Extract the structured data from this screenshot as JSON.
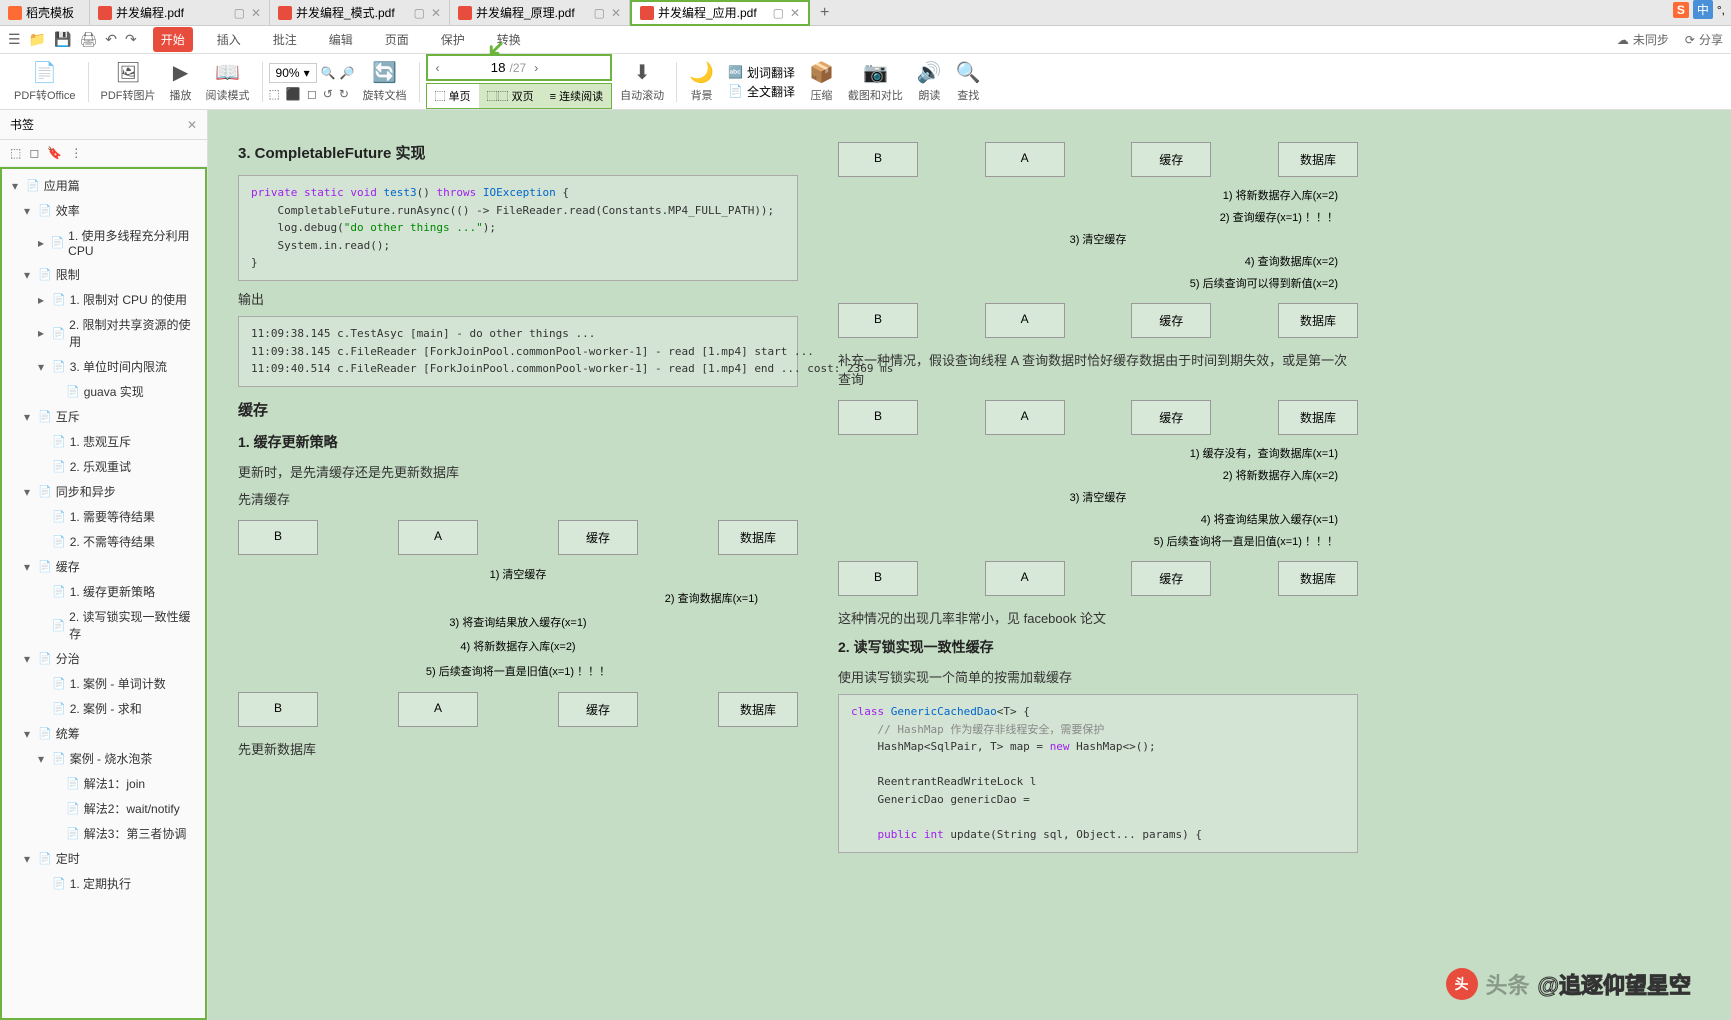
{
  "tabs": [
    {
      "icon": "orange",
      "label": "稻壳模板"
    },
    {
      "icon": "pdf",
      "label": "并发编程.pdf"
    },
    {
      "icon": "pdf",
      "label": "并发编程_模式.pdf"
    },
    {
      "icon": "pdf",
      "label": "并发编程_原理.pdf"
    },
    {
      "icon": "pdf",
      "label": "并发编程_应用.pdf",
      "active": true
    }
  ],
  "lang": {
    "s": "S",
    "cn": "中"
  },
  "menu": {
    "tabs": [
      "开始",
      "插入",
      "批注",
      "编辑",
      "页面",
      "保护",
      "转换"
    ],
    "active": "开始",
    "sync": "未同步",
    "share": "分享"
  },
  "toolbar": {
    "pdf_office": "PDF转Office",
    "pdf_img": "PDF转图片",
    "play": "播放",
    "read_mode": "阅读模式",
    "zoom": "90%",
    "rotate": "旋转文档",
    "page_current": "18",
    "page_total": "/27",
    "single": "单页",
    "double": "双页",
    "continuous": "连续阅读",
    "auto_scroll": "自动滚动",
    "bg": "背景",
    "word_trans": "划词翻译",
    "full_trans": "全文翻译",
    "compress": "压缩",
    "screenshot": "截图和对比",
    "read_aloud": "朗读",
    "find": "查找"
  },
  "sidebar": {
    "title": "书签",
    "items": [
      {
        "level": 0,
        "toggle": "▾",
        "label": "应用篇"
      },
      {
        "level": 1,
        "toggle": "▾",
        "label": "效率"
      },
      {
        "level": 2,
        "toggle": "▸",
        "label": "1. 使用多线程充分利用 CPU"
      },
      {
        "level": 1,
        "toggle": "▾",
        "label": "限制"
      },
      {
        "level": 2,
        "toggle": "▸",
        "label": "1. 限制对 CPU 的使用"
      },
      {
        "level": 2,
        "toggle": "▸",
        "label": "2. 限制对共享资源的使用"
      },
      {
        "level": 2,
        "toggle": "▾",
        "label": "3. 单位时间内限流"
      },
      {
        "level": 3,
        "toggle": "",
        "label": "guava 实现"
      },
      {
        "level": 1,
        "toggle": "▾",
        "label": "互斥"
      },
      {
        "level": 2,
        "toggle": "",
        "label": "1. 悲观互斥"
      },
      {
        "level": 2,
        "toggle": "",
        "label": "2. 乐观重试"
      },
      {
        "level": 1,
        "toggle": "▾",
        "label": "同步和异步"
      },
      {
        "level": 2,
        "toggle": "",
        "label": "1. 需要等待结果"
      },
      {
        "level": 2,
        "toggle": "",
        "label": "2. 不需等待结果"
      },
      {
        "level": 1,
        "toggle": "▾",
        "label": "缓存"
      },
      {
        "level": 2,
        "toggle": "",
        "label": "1. 缓存更新策略"
      },
      {
        "level": 2,
        "toggle": "",
        "label": "2. 读写锁实现一致性缓存"
      },
      {
        "level": 1,
        "toggle": "▾",
        "label": "分治"
      },
      {
        "level": 2,
        "toggle": "",
        "label": "1. 案例 - 单词计数"
      },
      {
        "level": 2,
        "toggle": "",
        "label": "2. 案例 - 求和"
      },
      {
        "level": 1,
        "toggle": "▾",
        "label": "统筹"
      },
      {
        "level": 2,
        "toggle": "▾",
        "label": "案例 - 烧水泡茶"
      },
      {
        "level": 3,
        "toggle": "",
        "label": "解法1：join"
      },
      {
        "level": 3,
        "toggle": "",
        "label": "解法2：wait/notify"
      },
      {
        "level": 3,
        "toggle": "",
        "label": "解法3：第三者协调"
      },
      {
        "level": 1,
        "toggle": "▾",
        "label": "定时"
      },
      {
        "level": 2,
        "toggle": "",
        "label": "1. 定期执行"
      }
    ]
  },
  "content": {
    "h1": "3. CompletableFuture 实现",
    "code1_l1": "private static void test3() throws IOException {",
    "code1_l2": "    CompletableFuture.runAsync(() -> FileReader.read(Constants.MP4_FULL_PATH));",
    "code1_l3": "    log.debug(\"do other things ...\");",
    "code1_l4": "    System.in.read();",
    "code1_l5": "}",
    "output_label": "输出",
    "output": "11:09:38.145 c.TestAsyc [main] - do other things ...\n11:09:38.145 c.FileReader [ForkJoinPool.commonPool-worker-1] - read [1.mp4] start ...\n11:09:40.514 c.FileReader [ForkJoinPool.commonPool-worker-1] - read [1.mp4] end ... cost: 2369 ms",
    "h2": "缓存",
    "h3": "1. 缓存更新策略",
    "p1": "更新时，是先清缓存还是先更新数据库",
    "p2": "先清缓存",
    "p3": "先更新数据库",
    "seq_actors": [
      "B",
      "A",
      "缓存",
      "数据库"
    ],
    "seq1_msgs": [
      "1) 清空缓存",
      "2) 查询数据库(x=1)",
      "3) 将查询结果放入缓存(x=1)",
      "4) 将新数据存入库(x=2)",
      "5) 后续查询将一直是旧值(x=1) ！！！"
    ],
    "right_p1": "补充一种情况，假设查询线程 A 查询数据时恰好缓存数据由于时间到期失效，或是第一次查询",
    "seq2_msgs": [
      "1) 将新数据存入库(x=2)",
      "2) 查询缓存(x=1) ！！！",
      "3) 清空缓存",
      "4) 查询数据库(x=2)",
      "5) 后续查询可以得到新值(x=2)"
    ],
    "seq3_msgs": [
      "1) 缓存没有，查询数据库(x=1)",
      "2) 将新数据存入库(x=2)",
      "3) 清空缓存",
      "4) 将查询结果放入缓存(x=1)",
      "5) 后续查询将一直是旧值(x=1) ！！！"
    ],
    "right_p2": "这种情况的出现几率非常小，见 facebook 论文",
    "h4": "2. 读写锁实现一致性缓存",
    "right_p3": "使用读写锁实现一个简单的按需加载缓存",
    "code2_l1": "class GenericCachedDao<T> {",
    "code2_l2": "    // HashMap 作为缓存非线程安全，需要保护",
    "code2_l3": "    HashMap<SqlPair, T> map = new HashMap<>();",
    "code2_l4": "    ReentrantReadWriteLock l",
    "code2_l5": "    GenericDao genericDao =",
    "code2_l6": "    public int update(String sql, Object... params) {"
  },
  "watermark": {
    "prefix": "头条",
    "text": "@追逐仰望星空"
  }
}
